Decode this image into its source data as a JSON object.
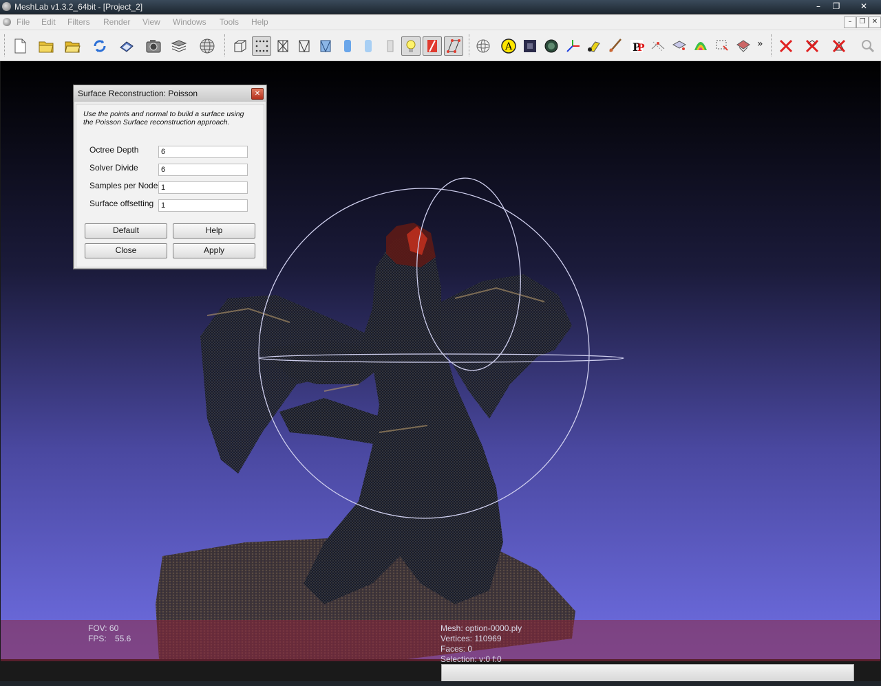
{
  "window": {
    "title": "MeshLab v1.3.2_64bit - [Project_2]",
    "controls": {
      "minimize": "–",
      "restore": "❐",
      "close": "✕"
    }
  },
  "menu": {
    "items": [
      "File",
      "Edit",
      "Filters",
      "Render",
      "View",
      "Windows",
      "Tools",
      "Help"
    ],
    "mdi_controls": {
      "minimize": "–",
      "restore": "❐",
      "close": "✕"
    }
  },
  "toolbar": {
    "overflow": "»",
    "groups": {
      "file": [
        "new-document-icon",
        "open-folder-icon",
        "open-project-icon",
        "reload-icon",
        "save-icon",
        "snapshot-icon",
        "layers-icon",
        "globe-grid-icon"
      ],
      "render": [
        "bounding-box-icon",
        "points-icon",
        "wireframe-icon",
        "hidden-lines-icon",
        "flat-shading-icon",
        "smooth-shading-icon",
        "texture-icon",
        "light-icon",
        "backface-icon",
        "double-side-icon"
      ],
      "edit": [
        "trackball-icon",
        "annotation-icon",
        "measure-icon",
        "paint-icon",
        "axes-icon",
        "manipulator-icon",
        "brush-icon",
        "pickpoints-icon",
        "align-icon",
        "select-vertex-icon",
        "select-face-icon",
        "select-area-icon",
        "select-connected-icon"
      ],
      "delete": [
        "delete-icon",
        "delete-faces-icon",
        "delete-vertices-icon",
        "search-icon"
      ]
    }
  },
  "dialog": {
    "title": "Surface Reconstruction: Poisson",
    "close": "✕",
    "description": "Use the points and normal to build a surface using the Poisson Surface reconstruction approach.",
    "params": [
      {
        "label": "Octree Depth",
        "value": "6"
      },
      {
        "label": "Solver Divide",
        "value": "6"
      },
      {
        "label": "Samples per Node",
        "value": "1"
      },
      {
        "label": "Surface offsetting",
        "value": "1"
      }
    ],
    "buttons": {
      "default": "Default",
      "help": "Help",
      "close": "Close",
      "apply": "Apply"
    }
  },
  "viewport": {
    "fov_text": "FOV: 60",
    "fps_label": "FPS:",
    "fps_value": "55.6",
    "mesh_name": "Mesh: option-0000.ply",
    "vertices": "Vertices: 110969",
    "faces": "Faces: 0",
    "selection": "Selection: v:0 f:0"
  },
  "colors": {
    "bg_top": "#000000",
    "bg_bottom": "#6f6ee3",
    "info_band": "#8c243c",
    "trackball": "#c9c9e9"
  }
}
